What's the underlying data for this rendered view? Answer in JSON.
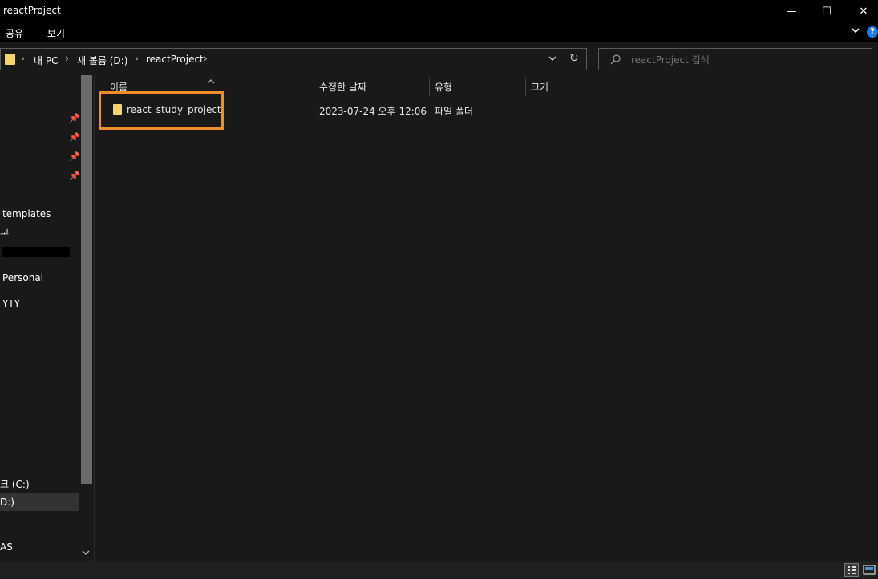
{
  "window": {
    "title": "reactProject",
    "minimize": "—",
    "maximize": "☐",
    "close": "✕"
  },
  "ribbon": {
    "tabs": [
      "공유",
      "보기"
    ],
    "expand_icon": "chevron-down",
    "help_icon": "?"
  },
  "address": {
    "breadcrumb": [
      "내 PC",
      "새 볼륨 (D:)",
      "reactProject"
    ],
    "separator": "›",
    "dropdown": "⌄",
    "refresh": "↻"
  },
  "search": {
    "placeholder": "reactProject 검색"
  },
  "navigation": {
    "pinned_count": 4,
    "items": [
      "templates",
      "ᆚ",
      "Personal",
      "YTY",
      "크 (C:)",
      "D:)",
      "AS"
    ]
  },
  "columns": {
    "name": "이름",
    "modified": "수정한 날짜",
    "type": "유형",
    "size": "크기"
  },
  "files": [
    {
      "name": "react_study_project",
      "modified": "2023-07-24 오후 12:06",
      "type": "파일 폴더",
      "size": ""
    }
  ],
  "colors": {
    "background": "#191919",
    "titlebar": "#000000",
    "highlight_border": "#f28c28",
    "folder": "#f6d46a",
    "help": "#1e7be0"
  }
}
